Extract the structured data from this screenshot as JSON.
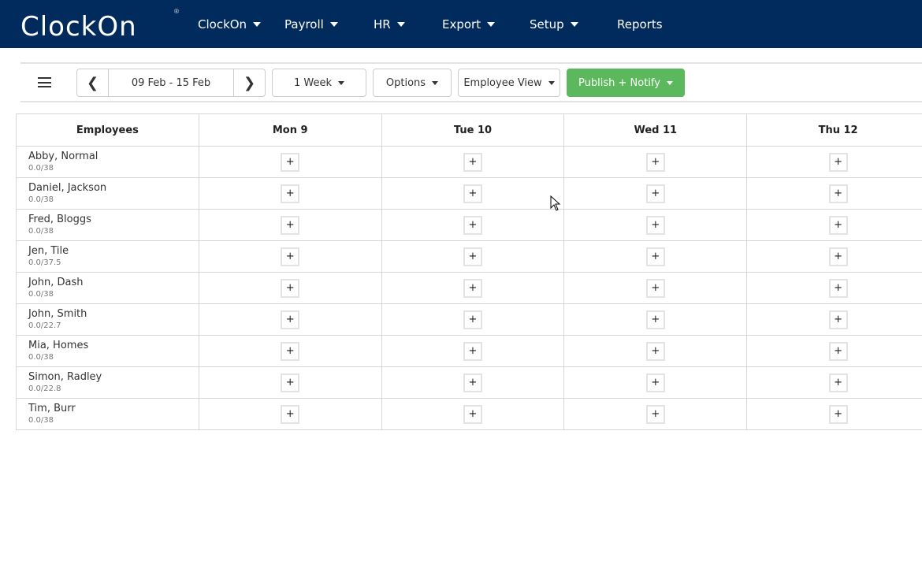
{
  "brand": {
    "logo_text": "ClockOn",
    "registered": "®",
    "accent_orange": "#f08a24",
    "accent_green": "#6cc04a",
    "accent_blue": "#4db8e8"
  },
  "nav": {
    "items": [
      {
        "label": "ClockOn",
        "dropdown": true
      },
      {
        "label": "Payroll",
        "dropdown": true
      },
      {
        "label": "HR",
        "dropdown": true
      },
      {
        "label": "Export",
        "dropdown": true
      },
      {
        "label": "Setup",
        "dropdown": true
      },
      {
        "label": "Reports",
        "dropdown": false
      }
    ]
  },
  "toolbar": {
    "date_range": "09 Feb - 15 Feb",
    "period": "1 Week",
    "options": "Options",
    "view": "Employee View",
    "publish": "Publish + Notify",
    "publish_color": "#5cb85c"
  },
  "table": {
    "columns": [
      "Employees",
      "Mon 9",
      "Tue 10",
      "Wed 11",
      "Thu 12"
    ],
    "add_label": "+",
    "rows": [
      {
        "name": "Abby, Normal",
        "hours": "0.0/38"
      },
      {
        "name": "Daniel, Jackson",
        "hours": "0.0/38"
      },
      {
        "name": "Fred, Bloggs",
        "hours": "0.0/38"
      },
      {
        "name": "Jen, Tile",
        "hours": "0.0/37.5"
      },
      {
        "name": "John, Dash",
        "hours": "0.0/38"
      },
      {
        "name": "John, Smith",
        "hours": "0.0/22.7"
      },
      {
        "name": "Mia, Homes",
        "hours": "0.0/38"
      },
      {
        "name": "Simon, Radley",
        "hours": "0.0/22.8"
      },
      {
        "name": "Tim, Burr",
        "hours": "0.0/38"
      }
    ]
  }
}
